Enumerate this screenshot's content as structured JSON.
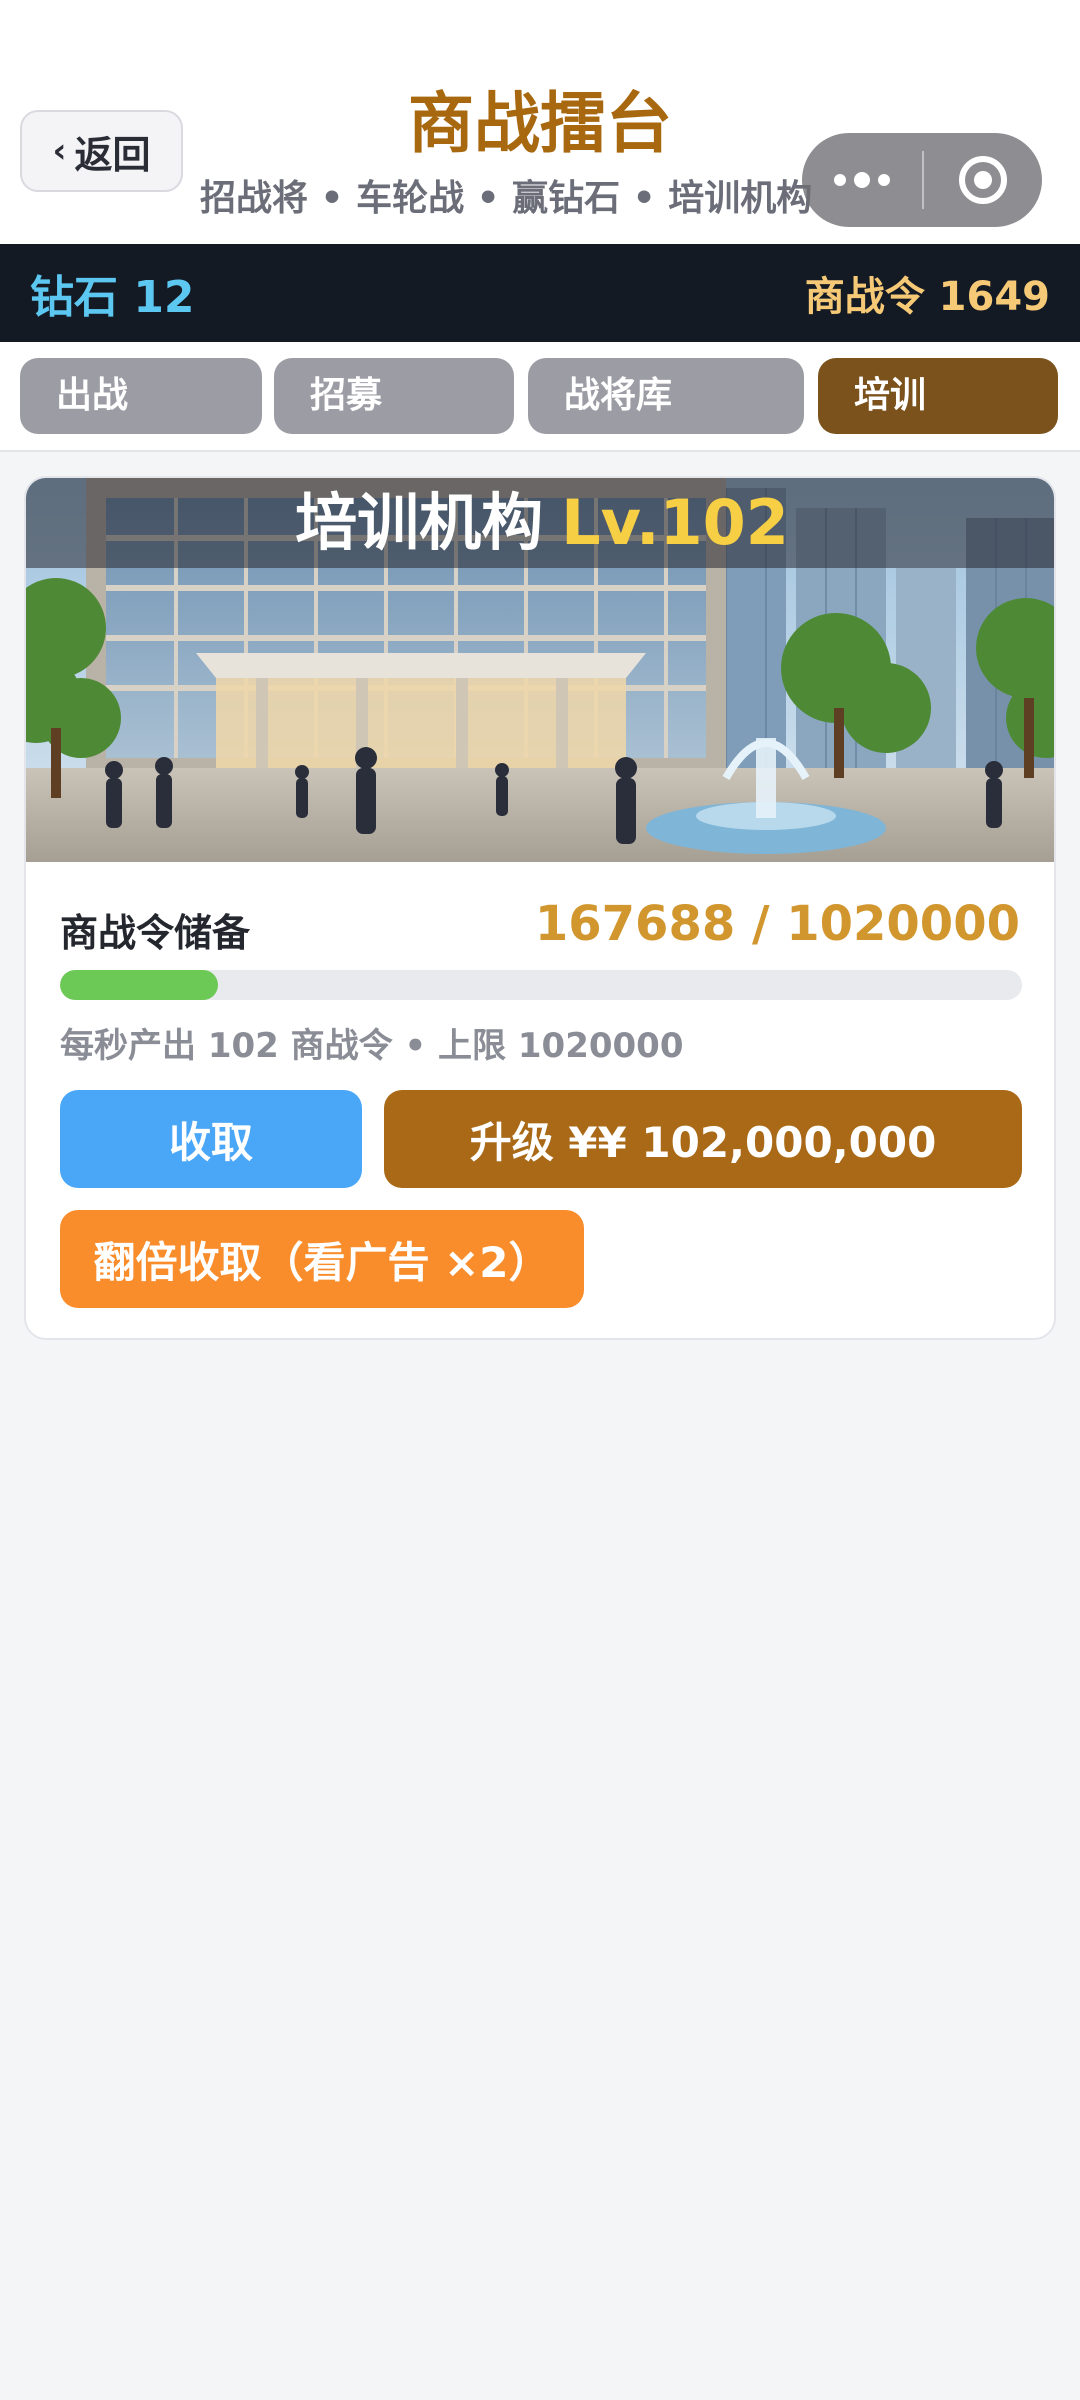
{
  "header": {
    "back_label": "返回",
    "title": "商战擂台",
    "subtitle": "招战将 • 车轮战 • 赢钻石 • 培训机构",
    "capsule_icons": [
      "more-dots-icon",
      "close-target-icon"
    ]
  },
  "currency": {
    "diamonds": "钻石 12",
    "tokens": "商战令 1649"
  },
  "tabs": [
    {
      "label": "出战",
      "active": false
    },
    {
      "label": "招募",
      "active": false
    },
    {
      "label": "战将库",
      "active": false
    },
    {
      "label": "培训",
      "active": true
    }
  ],
  "facility": {
    "name": "培训机构",
    "level": "Lv.102",
    "storage_label": "商战令储备",
    "storage_value": "167688 / 1020000",
    "storage_fraction": 0.164,
    "rate_text": "每秒产出 102 商战令 • 上限 1020000",
    "collect_label": "收取",
    "upgrade_label": "升级 ¥¥ 102,000,000",
    "double_collect_label": "翻倍收取（看广告 ×2）"
  },
  "colors": {
    "accent_gold": "#a8680f",
    "diamond_blue": "#5cc8f2",
    "token_gold": "#f6c977",
    "active_tab": "#7b521c",
    "collect_blue": "#4aa7f8",
    "upgrade_brown": "#a96917",
    "double_orange": "#f98d2c",
    "progress_green": "#6dc956"
  }
}
